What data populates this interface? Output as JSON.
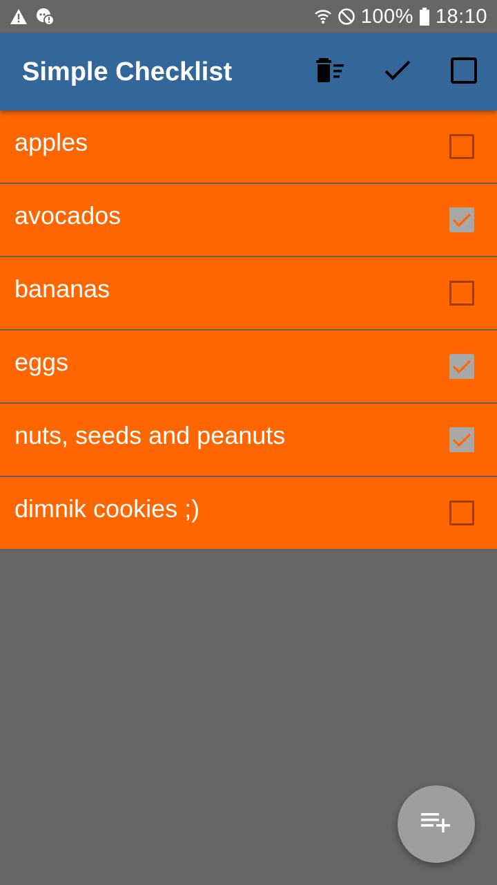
{
  "status_bar": {
    "icons_left": [
      "warning-icon",
      "notification-badge-icon"
    ],
    "icons_right": [
      "wifi-icon",
      "do-not-disturb-icon",
      "battery-icon"
    ],
    "battery": "100%",
    "time": "18:10"
  },
  "app_bar": {
    "title": "Simple Checklist",
    "actions": [
      "delete-checked-icon",
      "check-all-icon",
      "uncheck-all-icon"
    ]
  },
  "items": [
    {
      "label": "apples",
      "checked": false
    },
    {
      "label": "avocados",
      "checked": true
    },
    {
      "label": "bananas",
      "checked": false
    },
    {
      "label": "eggs",
      "checked": true
    },
    {
      "label": "nuts, seeds and peanuts",
      "checked": true
    },
    {
      "label": "dimnik cookies ;)",
      "checked": false
    }
  ],
  "fab": {
    "icon": "playlist-add-icon"
  },
  "colors": {
    "app_bar": "#336699",
    "item_bg": "#ff6600",
    "background": "#666666",
    "checked_box": "#a8a8a8",
    "fab": "#9e9e9e"
  }
}
